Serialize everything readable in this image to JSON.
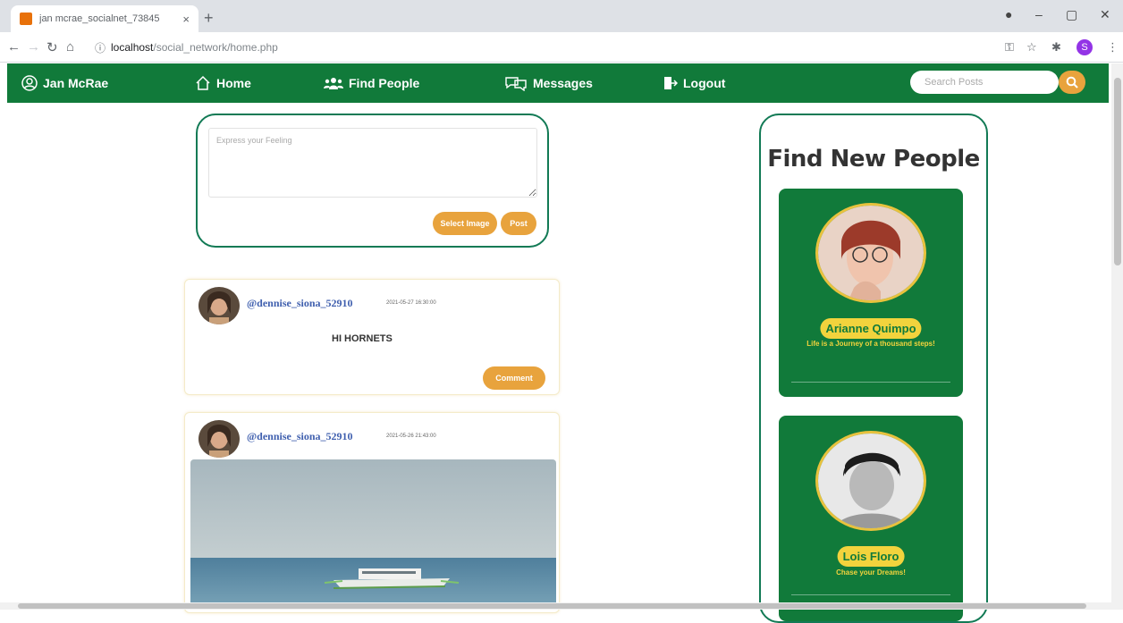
{
  "browser": {
    "tab_title": "jan mcrae_socialnet_73845",
    "url_host": "localhost",
    "url_path": "/social_network/home.php",
    "profile_initial": "S"
  },
  "navbar": {
    "user_name": "Jan McRae",
    "home": "Home",
    "find_people": "Find People",
    "messages": "Messages",
    "logout": "Logout",
    "search_placeholder": "Search Posts",
    "brand_color": "#117a3a",
    "accent_color": "#e8a33d"
  },
  "composer": {
    "placeholder": "Express your Feeling",
    "select_image": "Select Image",
    "post": "Post"
  },
  "posts": [
    {
      "username": "@dennise_siona_52910",
      "timestamp": "2021-05-27 16:30:00",
      "text": "HI HORNETS",
      "comment": "Comment"
    },
    {
      "username": "@dennise_siona_52910",
      "timestamp": "2021-05-26 21:43:00"
    }
  ],
  "sidebar": {
    "title": "Find New People",
    "people": [
      {
        "name": "Arianne Quimpo",
        "bio": "Life is a Journey of a thousand steps!"
      },
      {
        "name": "Lois Floro",
        "bio": "Chase your Dreams!"
      }
    ]
  }
}
